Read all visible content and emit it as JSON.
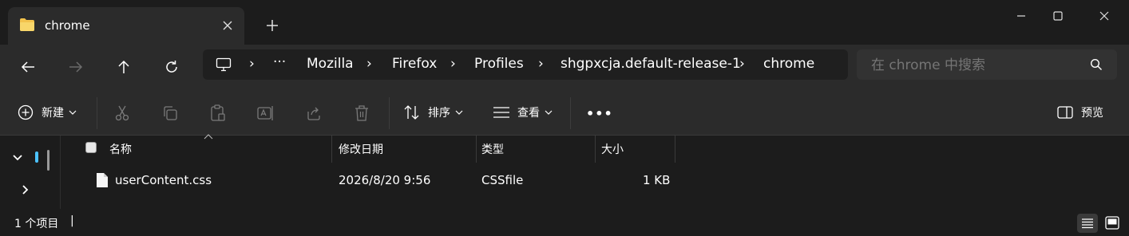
{
  "window": {
    "tab_title": "chrome",
    "icons": {
      "folder": "folder-icon",
      "close_tab": "close-icon",
      "new_tab": "plus-icon",
      "minimize": "minimize-icon",
      "maximize": "maximize-icon",
      "close": "close-icon"
    }
  },
  "nav": {
    "icons": [
      "back-arrow-icon",
      "forward-arrow-icon",
      "up-arrow-icon",
      "refresh-icon"
    ],
    "breadcrumb": [
      "Mozilla",
      "Firefox",
      "Profiles",
      "shgpxcja.default-release-1",
      "chrome"
    ],
    "overflow": "···",
    "search_placeholder": "在 chrome 中搜索"
  },
  "commands": {
    "new_label": "新建",
    "sort_label": "排序",
    "view_label": "查看",
    "more_label": "•••",
    "preview_label": "预览"
  },
  "columns": {
    "name": "名称",
    "modified": "修改日期",
    "type": "类型",
    "size": "大小"
  },
  "files": [
    {
      "name": "userContent.css",
      "modified": "2026/8/20 9:56",
      "type": "CSSfile",
      "size": "1 KB"
    }
  ],
  "status": {
    "count_text": "1 个项目",
    "cursor": "|"
  },
  "colors": {
    "accent": "#4cc2ff",
    "folder": "#f3c34d",
    "chrome_bg": "#2b2b2b",
    "content_bg": "#1c1c1c"
  }
}
